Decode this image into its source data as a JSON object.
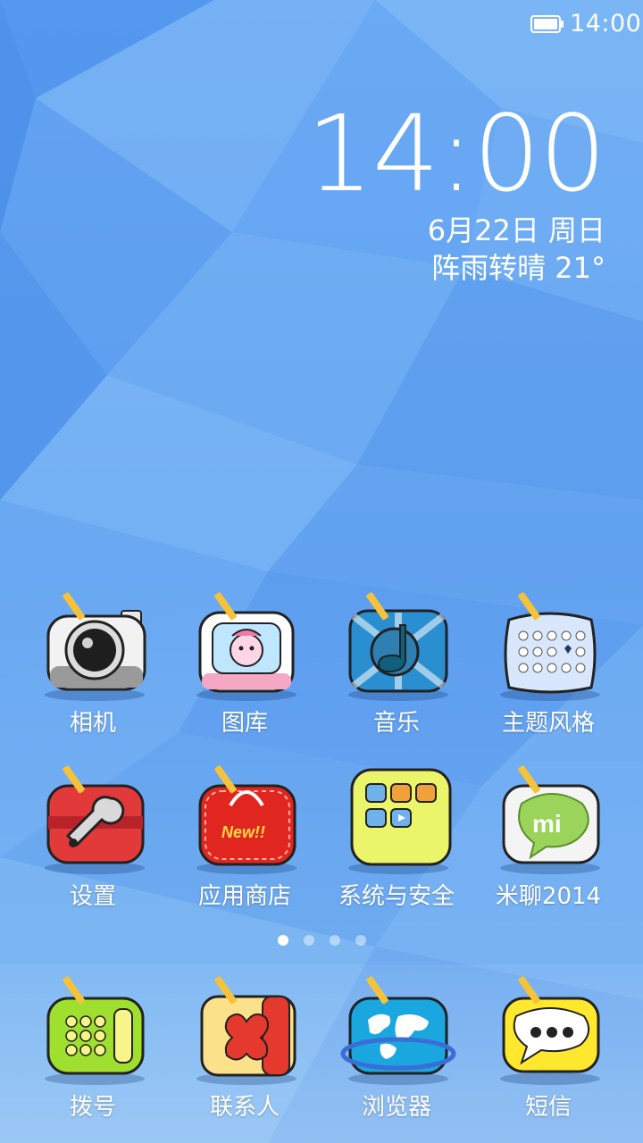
{
  "status_bar": {
    "time": "14:00",
    "battery_icon": "battery-full-icon"
  },
  "clock_widget": {
    "time": "14:00",
    "date": "6月22日 周日",
    "weather": "阵雨转晴  21°"
  },
  "home_apps": [
    {
      "label": "相机",
      "icon": "camera-icon"
    },
    {
      "label": "图库",
      "icon": "gallery-icon"
    },
    {
      "label": "音乐",
      "icon": "music-icon"
    },
    {
      "label": "主题风格",
      "icon": "theme-icon"
    },
    {
      "label": "设置",
      "icon": "settings-icon"
    },
    {
      "label": "应用商店",
      "icon": "app-store-icon"
    },
    {
      "label": "系统与安全",
      "icon": "system-security-icon"
    },
    {
      "label": "米聊2014",
      "icon": "miliao-icon"
    }
  ],
  "pager": {
    "total": 4,
    "active": 1
  },
  "dock_apps": [
    {
      "label": "拨号",
      "icon": "phone-dialer-icon"
    },
    {
      "label": "联系人",
      "icon": "contacts-icon"
    },
    {
      "label": "浏览器",
      "icon": "browser-icon"
    },
    {
      "label": "短信",
      "icon": "messages-icon"
    }
  ],
  "colors": {
    "wallpaper_light": "#8cc0f6",
    "wallpaper_dark": "#3e86e6"
  }
}
